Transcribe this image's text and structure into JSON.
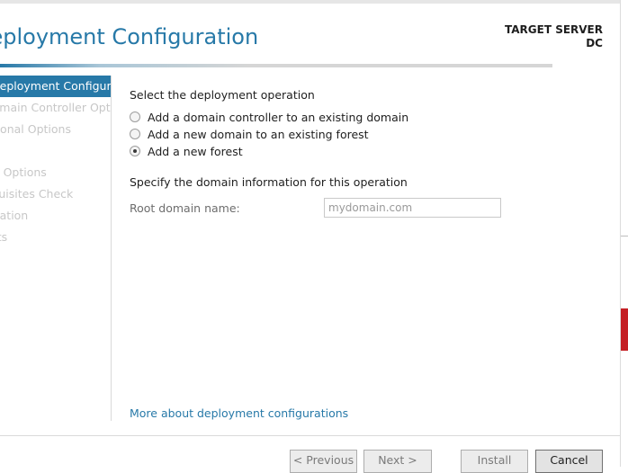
{
  "header": {
    "title": "Deployment Configuration",
    "target_server_label": "TARGET SERVER",
    "target_server_name": "DC"
  },
  "nav": {
    "items": [
      {
        "label": "Deployment Configuration",
        "active": true
      },
      {
        "label": "Domain Controller Options",
        "active": false
      },
      {
        "label": "Additional Options",
        "active": false
      },
      {
        "label": "",
        "active": false
      },
      {
        "label": "Review Options",
        "active": false
      },
      {
        "label": "Prerequisites Check",
        "active": false
      },
      {
        "label": "Installation",
        "active": false
      },
      {
        "label": "Results",
        "active": false
      }
    ]
  },
  "main": {
    "operation_heading": "Select the deployment operation",
    "options": [
      {
        "label": "Add a domain controller to an existing domain",
        "checked": false
      },
      {
        "label": "Add a new domain to an existing forest",
        "checked": false
      },
      {
        "label": "Add a new forest",
        "checked": true
      }
    ],
    "domain_heading": "Specify the domain information for this operation",
    "root_domain_label": "Root domain name:",
    "root_domain_value": "",
    "root_domain_placeholder": "mydomain.com",
    "more_link": "More about deployment configurations"
  },
  "footer": {
    "previous_label": "< Previous",
    "next_label": "Next >",
    "install_label": "Install",
    "cancel_label": "Cancel"
  },
  "colors": {
    "accent": "#2779a8",
    "disabled_text": "#c7c7c7",
    "edge_red": "#c41f24"
  }
}
